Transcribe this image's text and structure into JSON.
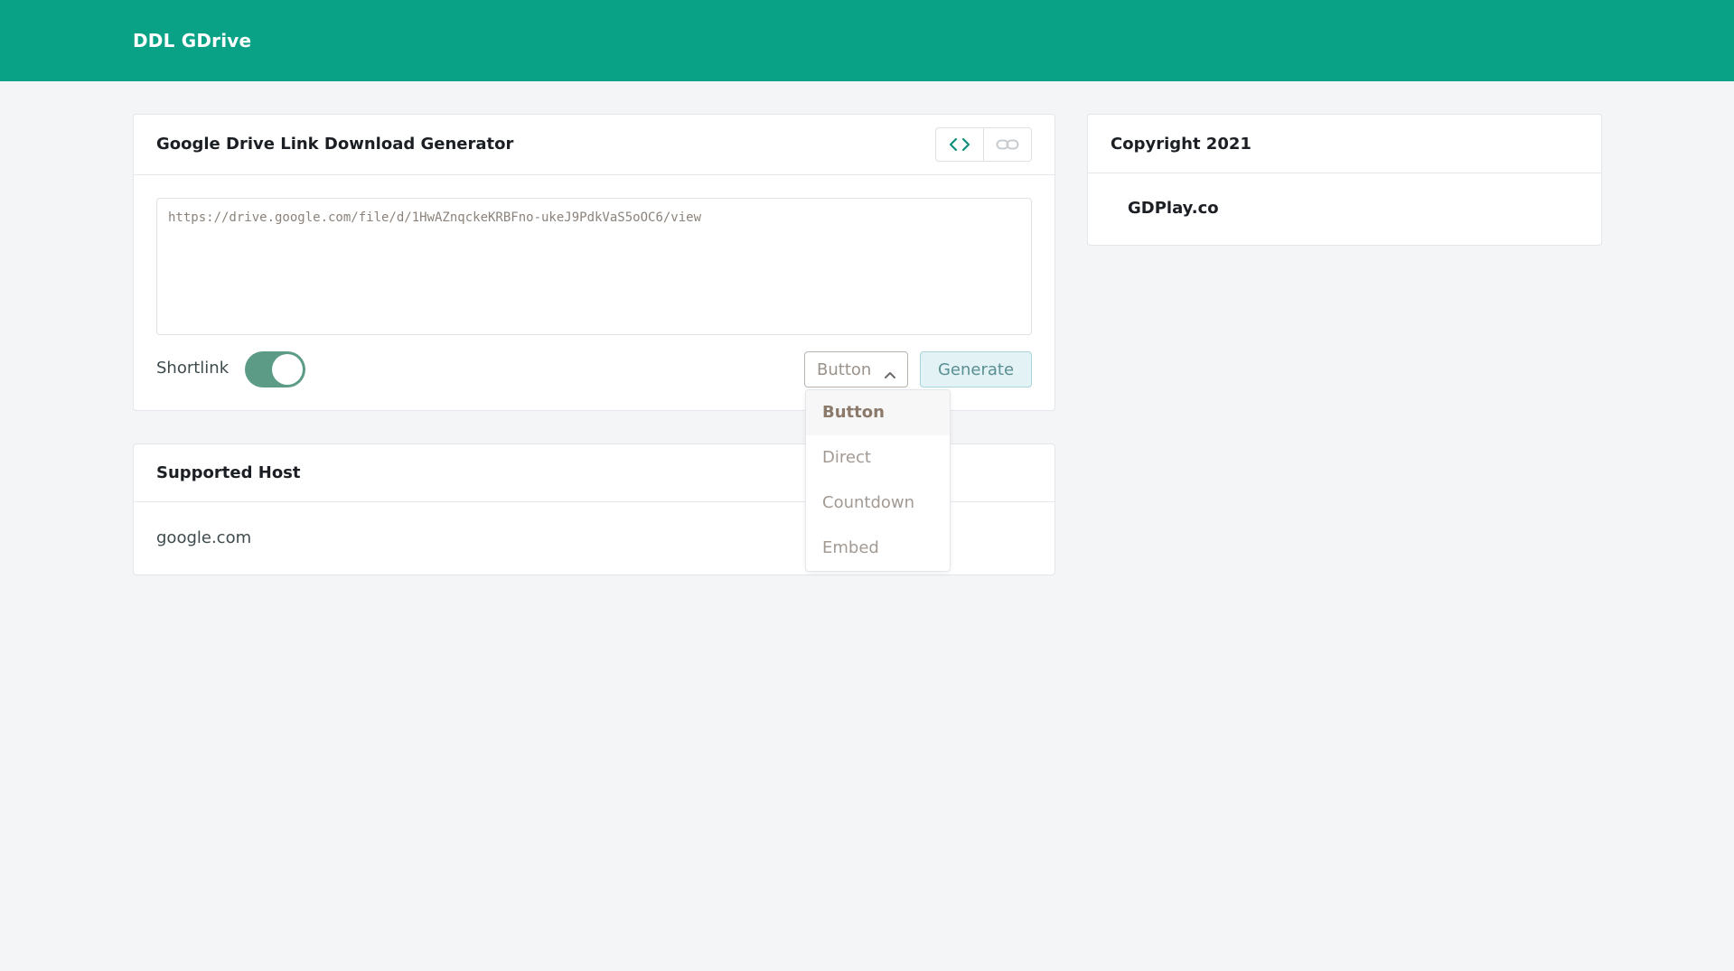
{
  "header": {
    "brand": "DDL GDrive"
  },
  "generator": {
    "title": "Google Drive Link Download Generator",
    "toolbar_icons": [
      "code-icon",
      "link-icon"
    ],
    "url_value": "https://drive.google.com/file/d/1HwAZnqckeKRBFno-ukeJ9PdkVaS5oOC6/view",
    "shortlink_label": "Shortlink",
    "shortlink_enabled": true,
    "select_value": "Button",
    "generate_label": "Generate"
  },
  "dropdown": {
    "options": [
      "Button",
      "Direct",
      "Countdown",
      "Embed"
    ],
    "selected": "Button"
  },
  "supported_host": {
    "title": "Supported Host",
    "hosts": [
      "google.com"
    ]
  },
  "copyright": {
    "title": "Copyright 2021",
    "link": "GDPlay.co"
  },
  "colors": {
    "accent": "#0aa287",
    "toggle_on": "#5c9b85",
    "background": "#f4f5f7"
  }
}
